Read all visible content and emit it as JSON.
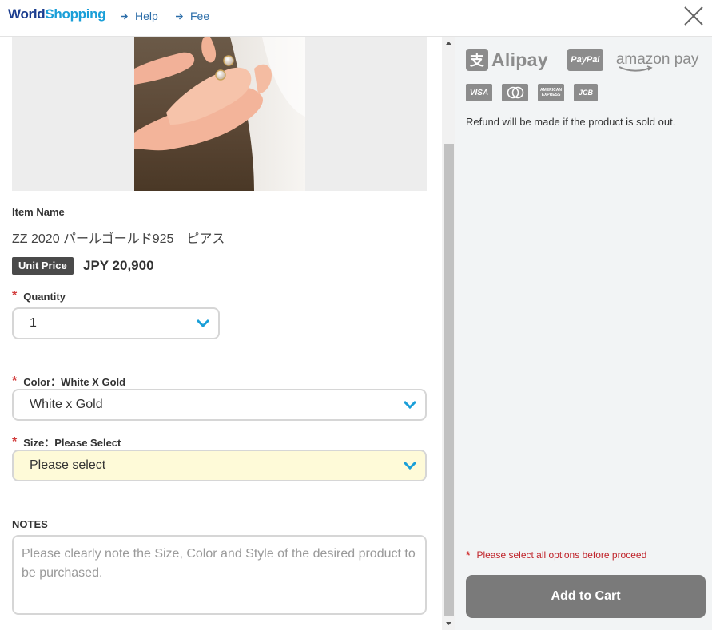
{
  "header": {
    "logo_w": "W",
    "logo_rest": "orld",
    "logo_shopping": "Shopping",
    "nav": [
      {
        "label": "Help"
      },
      {
        "label": "Fee"
      }
    ]
  },
  "product": {
    "item_name_label": "Item Name",
    "item_name": "ZZ 2020 パールゴールド925　ピアス",
    "unit_price_label": "Unit Price",
    "unit_price": "JPY 20,900"
  },
  "quantity": {
    "label": "Quantity",
    "value": "1"
  },
  "color": {
    "label": "Color：White X Gold",
    "value": "White x Gold"
  },
  "size": {
    "label": "Size：Please Select",
    "value": "Please select"
  },
  "notes": {
    "label": "NOTES",
    "placeholder": "Please clearly note the Size, Color and Style of the desired product to be purchased."
  },
  "payment": {
    "alipay": "Alipay",
    "alipay_glyph": "支",
    "paypal": "PayPal",
    "amazon": "amazon pay",
    "cards": [
      "VISA",
      "",
      "AMERICAN EXPRESS",
      "JCB"
    ],
    "refund_note": "Refund will be made if the product is sold out."
  },
  "cart": {
    "warning": "Please select all options before proceed",
    "button": "Add to Cart"
  },
  "colors": {
    "accent_blue": "#1a9fd8",
    "required_red": "#d23b3b",
    "warning_bg": "#fefad8",
    "button_gray": "#7a7a7a"
  }
}
